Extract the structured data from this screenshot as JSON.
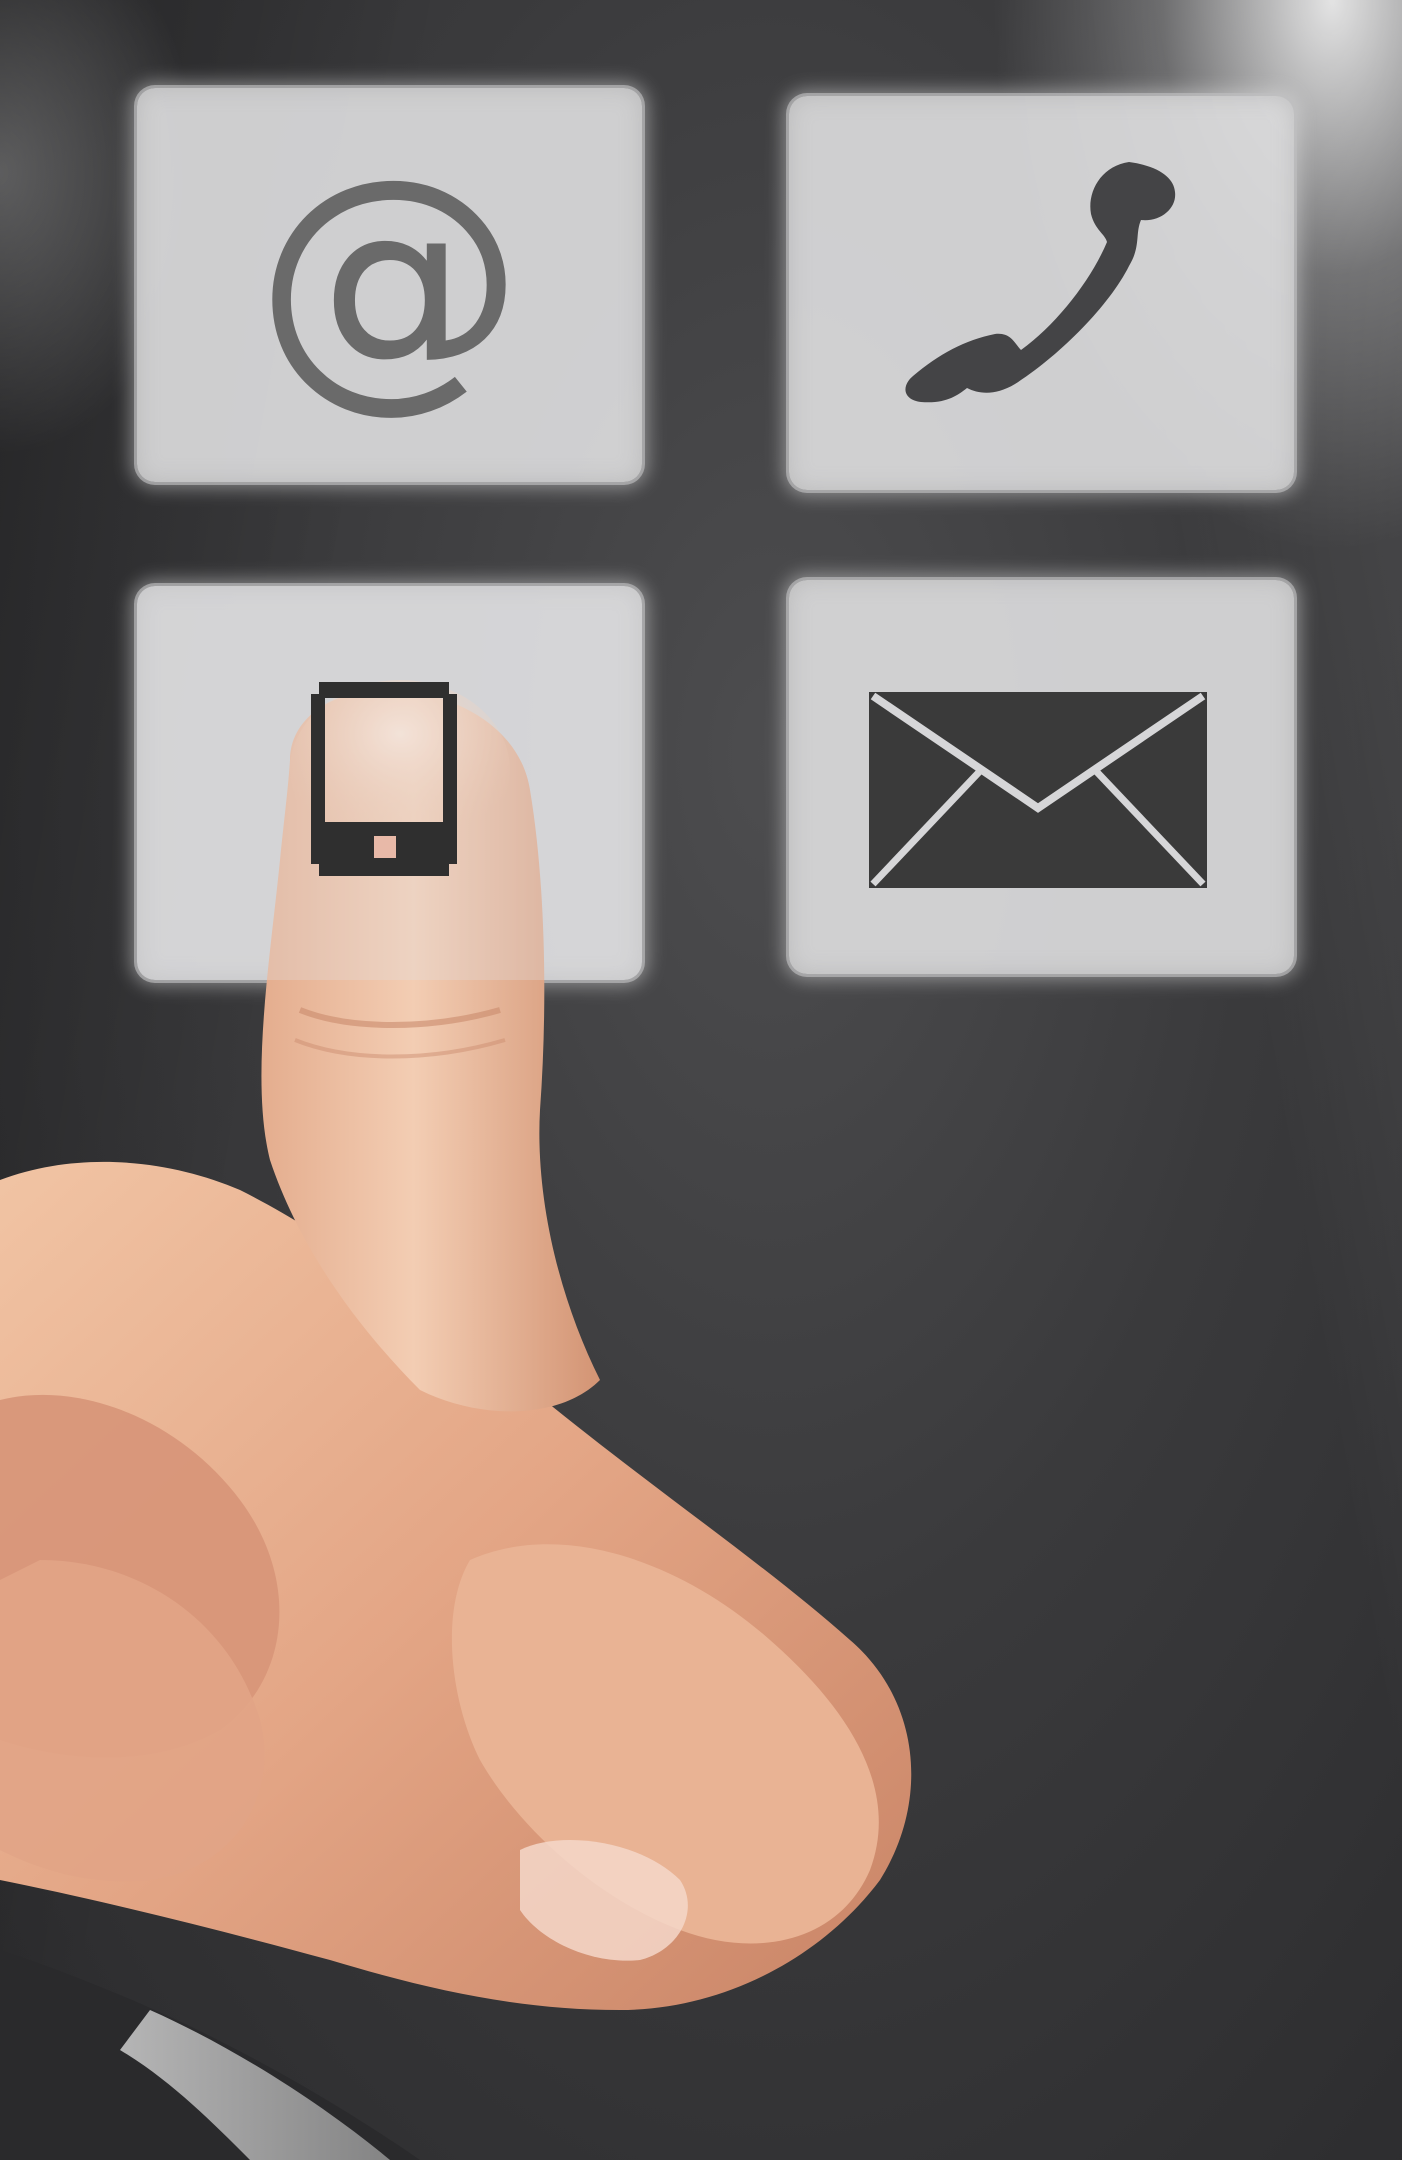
{
  "scene": {
    "background_color": "#3a3a3c",
    "tile_color": "#dadadc",
    "icon_color": "#3b3b3b"
  },
  "tiles": [
    {
      "icon": "at-sign-icon",
      "glyph": "@"
    },
    {
      "icon": "telephone-handset-icon"
    },
    {
      "icon": "mobile-phone-icon",
      "pressed": true
    },
    {
      "icon": "envelope-icon"
    }
  ]
}
